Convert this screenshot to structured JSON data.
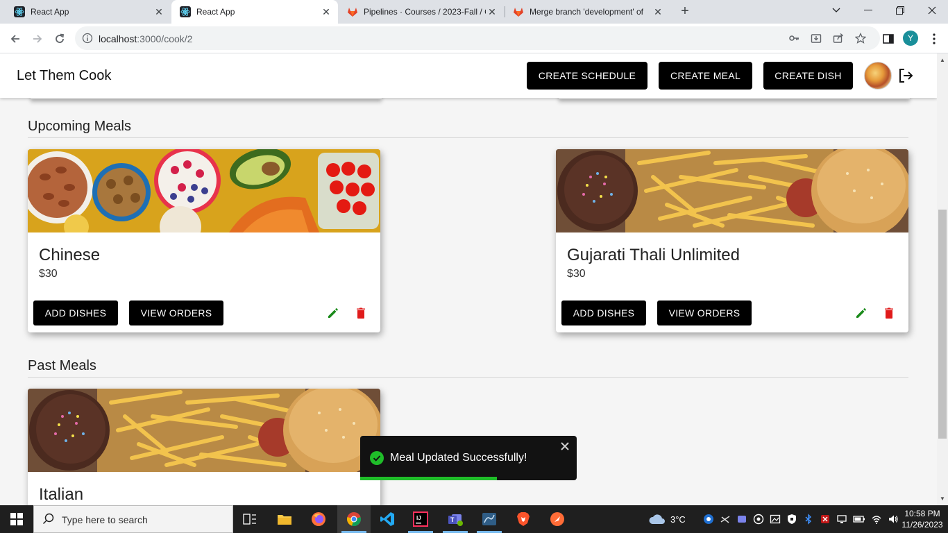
{
  "browser": {
    "tabs": [
      {
        "title": "React App",
        "active": false
      },
      {
        "title": "React App",
        "active": true
      },
      {
        "title": "Pipelines · Courses / 2023-Fall / C",
        "active": false
      },
      {
        "title": "Merge branch 'development' of",
        "active": false
      }
    ],
    "url_host": "localhost",
    "url_path": ":3000/cook/2",
    "profile_initial": "Y"
  },
  "app": {
    "brand": "Let Them Cook",
    "nav_buttons": {
      "create_schedule": "CREATE SCHEDULE",
      "create_meal": "CREATE MEAL",
      "create_dish": "CREATE DISH"
    }
  },
  "sections": {
    "upcoming_title": "Upcoming Meals",
    "past_title": "Past Meals"
  },
  "upcoming_meals": [
    {
      "name": "Chinese",
      "price": "$30",
      "image": "healthy-foods"
    },
    {
      "name": "Gujarati Thali Unlimited",
      "price": "$30",
      "image": "burger-fries"
    }
  ],
  "past_meals": [
    {
      "name": "Italian",
      "image": "burger-fries"
    }
  ],
  "card_actions": {
    "add_dishes": "ADD DISHES",
    "view_orders": "VIEW ORDERS"
  },
  "toast": {
    "message": "Meal Updated Successfully!",
    "progress": 0.63
  },
  "taskbar": {
    "search_placeholder": "Type here to search",
    "weather": "3°C",
    "time": "10:58 PM",
    "date": "11/26/2023"
  },
  "colors": {
    "edit_icon": "#1a8a1a",
    "delete_icon": "#e01b1b",
    "toast_success": "#1fbd29",
    "button_bg": "#000000"
  }
}
